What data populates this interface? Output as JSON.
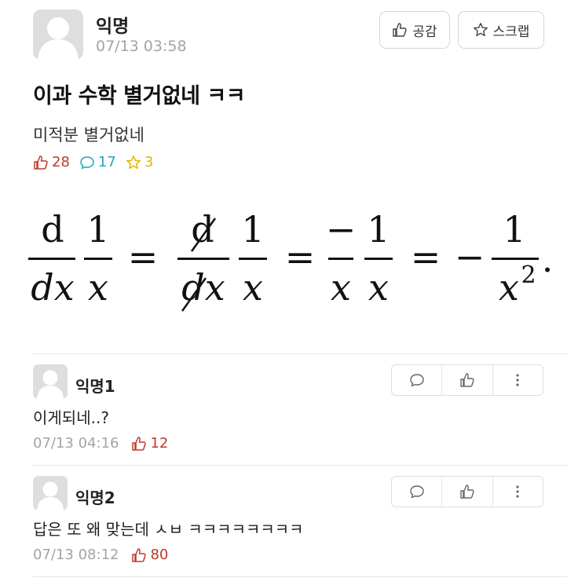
{
  "post": {
    "author": "익명",
    "time": "07/13 03:58",
    "like_button": "공감",
    "scrap_button": "스크랩",
    "title": "이과 수학 별거없네 ㅋㅋ",
    "body": "미적분 별거없네",
    "stats": {
      "likes": "28",
      "comments": "17",
      "scraps": "3"
    }
  },
  "formula": {
    "d": "d",
    "dx": "dx",
    "one": "1",
    "x": "x",
    "equals": "=",
    "minus": "−",
    "exponent": "2",
    "period": "."
  },
  "comments": [
    {
      "author": "익명1",
      "text": "이게되네..?",
      "time": "07/13 04:16",
      "likes": "12"
    },
    {
      "author": "익명2",
      "text": "답은 또 왜 맞는데 ㅅㅂ ㅋㅋㅋㅋㅋㅋㅋㅋ",
      "time": "07/13 08:12",
      "likes": "80"
    }
  ],
  "colors": {
    "like": "#c0392b",
    "comment": "#1ea7c4",
    "scrap": "#e3b400",
    "meta": "#a4a4a4"
  },
  "icons": [
    "avatar-icon",
    "thumbs-up-icon",
    "star-icon",
    "speech-bubble-icon",
    "more-vertical-icon"
  ]
}
